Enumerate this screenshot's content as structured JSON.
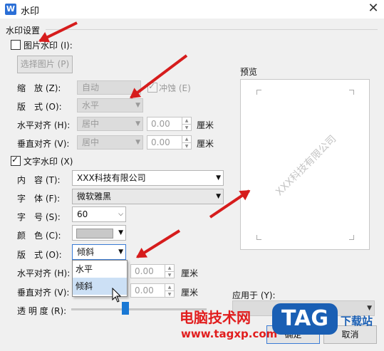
{
  "window": {
    "app_icon_letter": "W",
    "title": "水印"
  },
  "section": {
    "title": "水印设置"
  },
  "picture_wm": {
    "checkbox_label": "图片水印 (I):",
    "checked": false,
    "select_button": "选择图片 (P)",
    "scale_label": "缩　放 (Z):",
    "scale_value": "自动",
    "washout_label": "冲蚀 (E)",
    "layout_label": "版　式 (O):",
    "layout_value": "水平",
    "halign_label": "水平对齐 (H):",
    "halign_value": "居中",
    "halign_offset": "0.00",
    "valign_label": "垂直对齐 (V):",
    "valign_value": "居中",
    "valign_offset": "0.00",
    "unit": "厘米"
  },
  "text_wm": {
    "checkbox_label": "文字水印 (X)",
    "checked": true,
    "content_label": "内　容 (T):",
    "content_value": "XXX科技有限公司",
    "font_label": "字　体 (F):",
    "font_value": "微软雅黑",
    "size_label": "字　号 (S):",
    "size_value": "60",
    "color_label": "颜　色 (C):",
    "layout_label": "版　式 (O):",
    "layout_value": "倾斜",
    "halign_label": "水平对齐 (H):",
    "halign_offset": "0.00",
    "valign_label": "垂直对齐 (V):",
    "valign_offset": "0.00",
    "unit": "厘米",
    "transparency_label": "透 明 度 (R):",
    "layout_options": [
      "水平",
      "倾斜"
    ],
    "layout_selected": "倾斜"
  },
  "preview": {
    "label": "预览",
    "watermark_text": "XXX科技有限公司"
  },
  "apply": {
    "label": "应用于 (Y):"
  },
  "buttons": {
    "ok": "确定",
    "cancel": "取消"
  },
  "overlay": {
    "site_name": "电脑技术网",
    "site_url": "www.tagxp.com",
    "logo": "TAG",
    "logo_sub": "下载站"
  },
  "colors": {
    "annotation_arrow": "#d61c1c",
    "color_swatch": "#c8c8c8",
    "logo_blue": "#1a5fb4",
    "site_red": "#e11d1d"
  }
}
